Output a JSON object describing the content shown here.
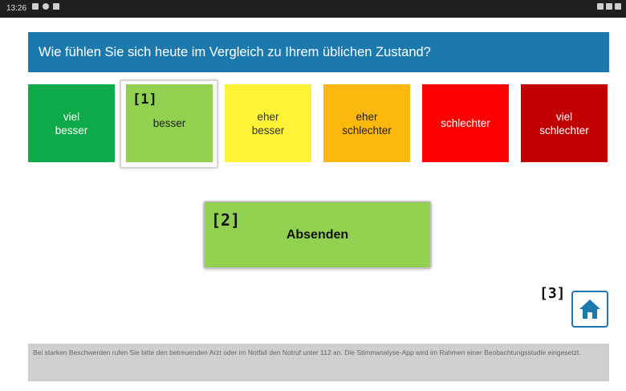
{
  "status_bar": {
    "time": "13:26"
  },
  "question": "Wie fühlen Sie sich heute im Vergleich zu Ihrem üblichen Zustand?",
  "options": [
    {
      "label": "viel\nbesser",
      "color": "#0eaa49"
    },
    {
      "label": "besser",
      "color": "#92d050"
    },
    {
      "label": "eher\nbesser",
      "color": "#fff338"
    },
    {
      "label": "eher\nschlechter",
      "color": "#fdb80d"
    },
    {
      "label": "schlechter",
      "color": "#fe0000"
    },
    {
      "label": "viel\nschlechter",
      "color": "#c00000"
    }
  ],
  "annotations": {
    "tag_1": "[1]",
    "tag_2": "[2]",
    "tag_3": "[3]"
  },
  "submit_label": "Absenden",
  "home_icon": "home-icon",
  "footer_text": "Bei starken Beschwerden rufen Sie bitte den betreuenden Arzt oder im Notfall den Notruf unter 112 an. Die Stimmanalyse-App wird im Rahmen einer Beobachtungsstudie eingesetzt.",
  "colors": {
    "accent": "#1c79ae",
    "footer_bg": "#cfcfcf"
  }
}
